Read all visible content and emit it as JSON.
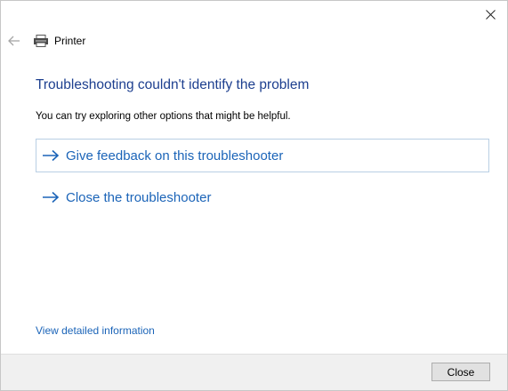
{
  "window": {
    "title": "Printer",
    "title_icon": "printer-icon",
    "close_icon": "close-icon",
    "back_icon": "back-arrow-icon"
  },
  "main": {
    "heading": "Troubleshooting couldn't identify the problem",
    "subtext": "You can try exploring other options that might be helpful.",
    "options": [
      {
        "label": "Give feedback on this troubleshooter",
        "icon": "arrow-right-icon"
      },
      {
        "label": "Close the troubleshooter",
        "icon": "arrow-right-icon"
      }
    ],
    "detail_link": "View detailed information"
  },
  "footer": {
    "close_label": "Close"
  },
  "colors": {
    "heading": "#1d3f8f",
    "link": "#1b64b8",
    "focus_border": "#b9cfe4",
    "footer_bg": "#f0f0f0"
  }
}
